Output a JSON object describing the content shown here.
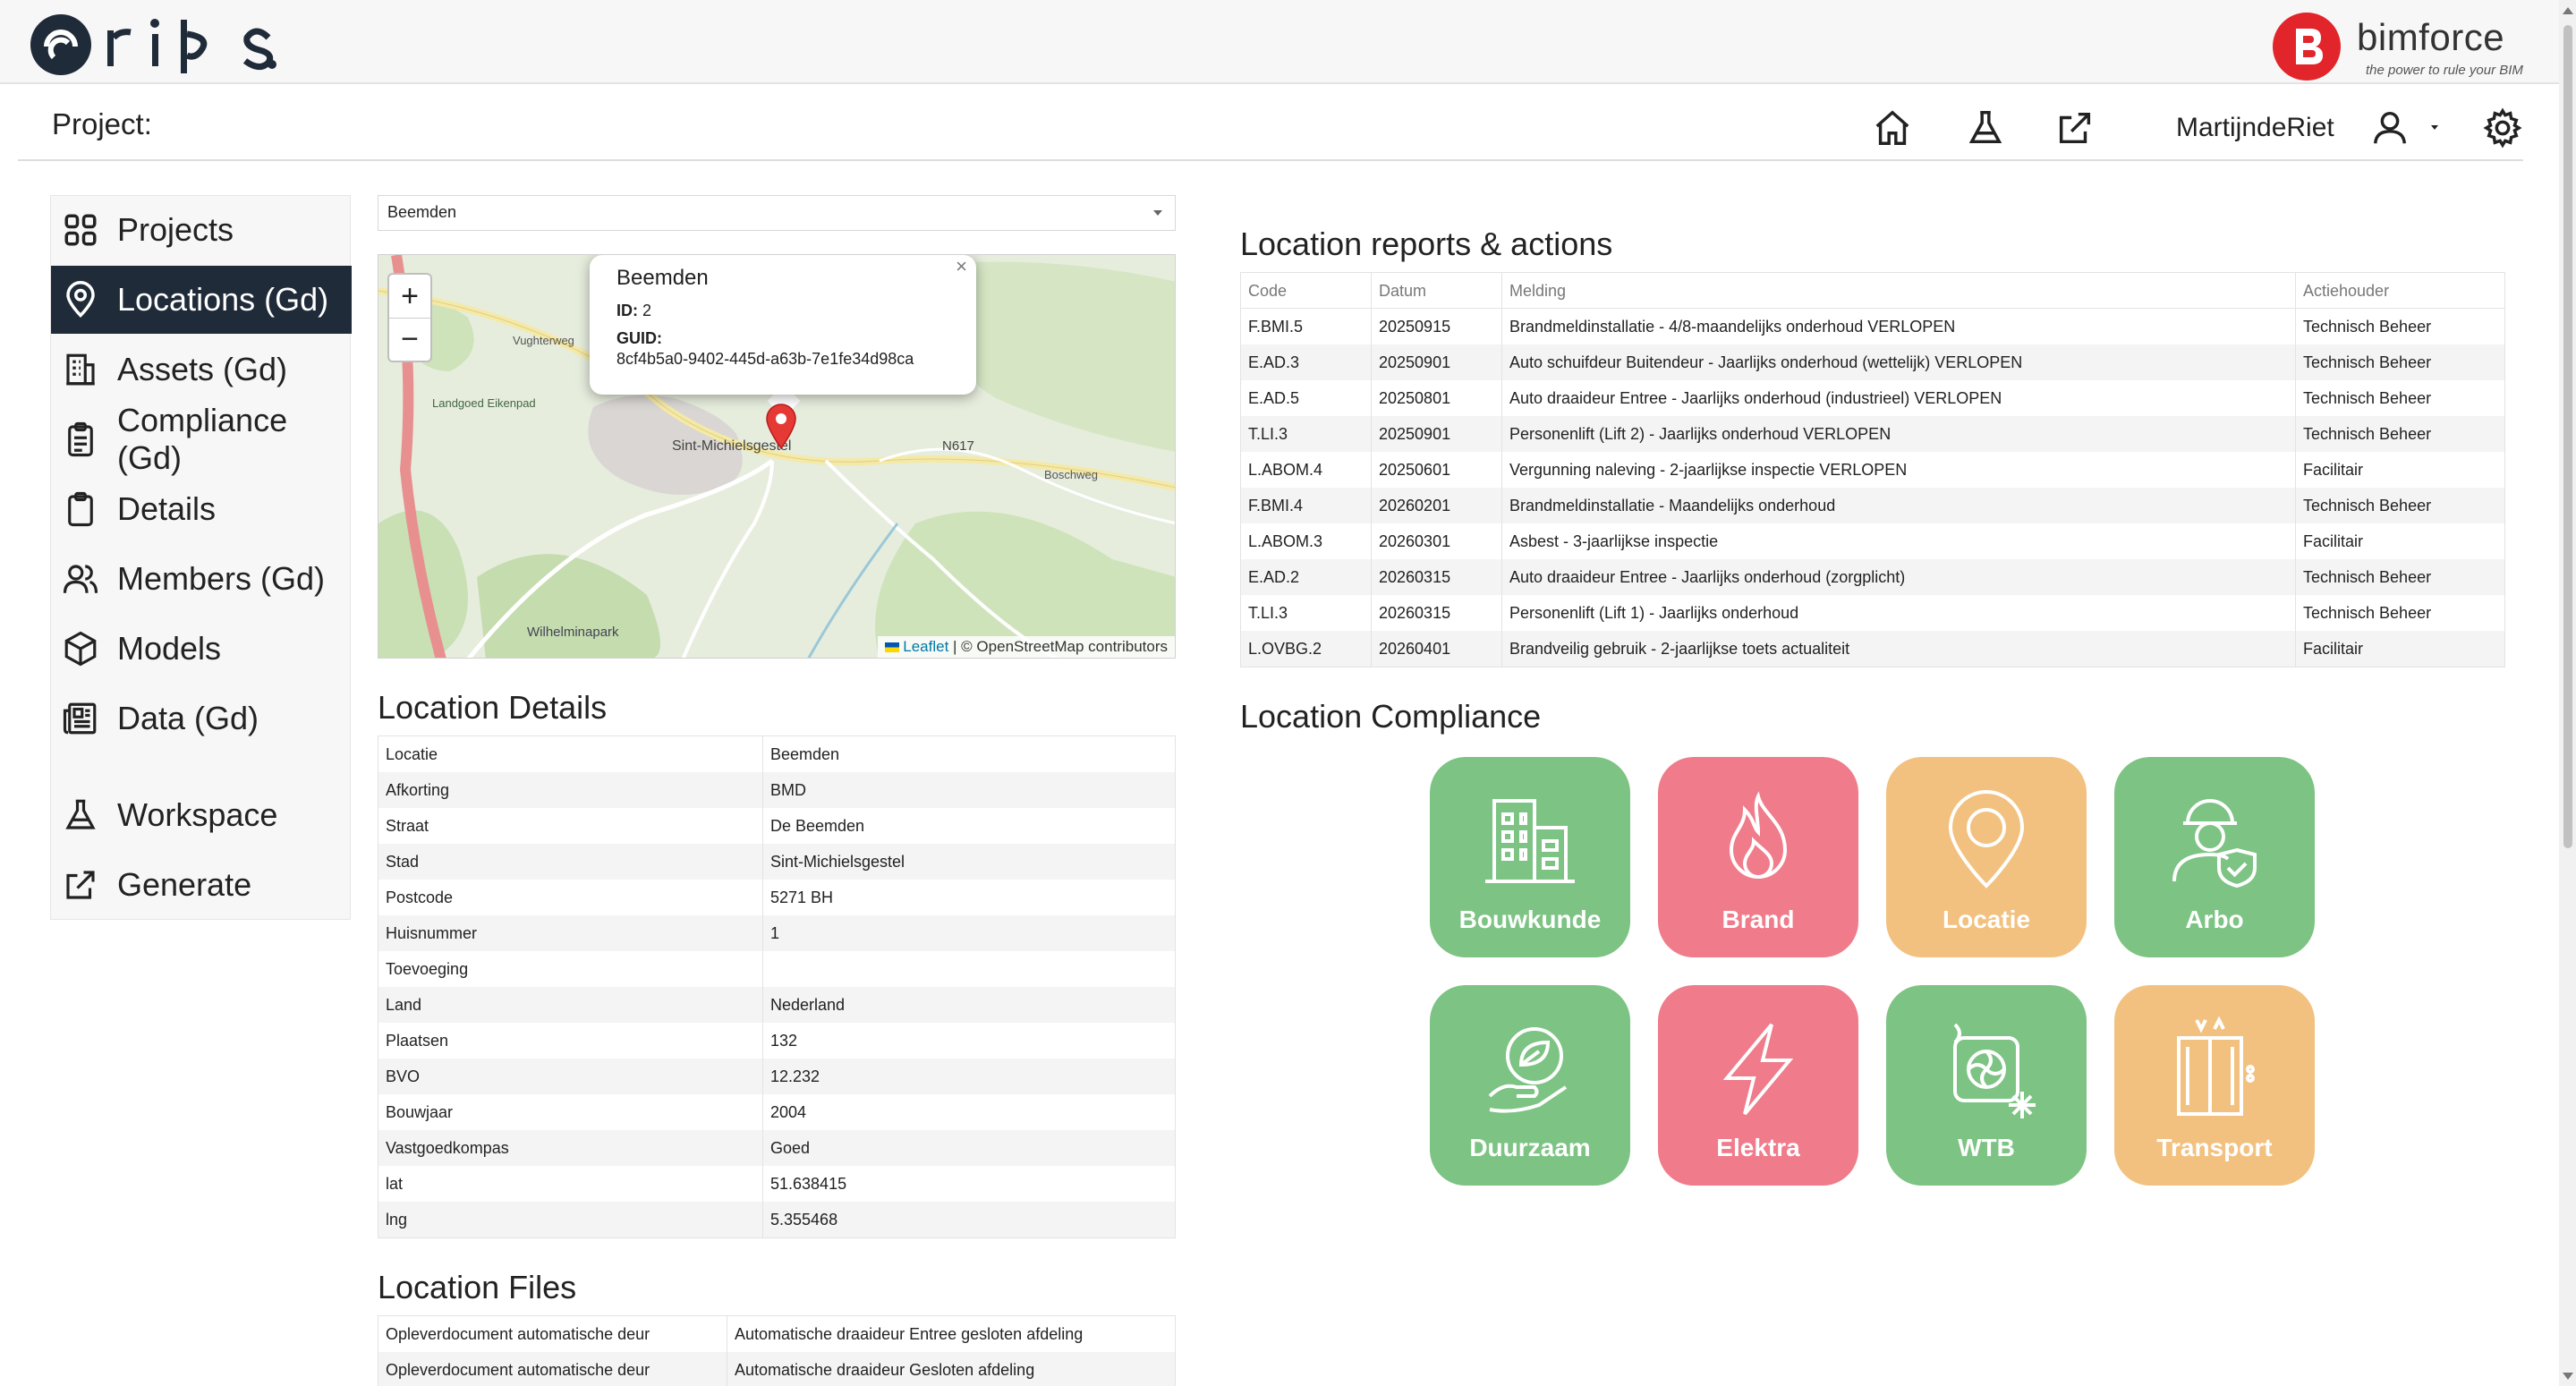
{
  "brand": {
    "app_name": "rips",
    "partner_name": "bimforce",
    "partner_tagline": "the power to rule your BIM",
    "partner_color": "#e2242b"
  },
  "header": {
    "project_label": "Project:",
    "user_name": "MartijndeRiet"
  },
  "sidebar": {
    "items": [
      {
        "label": "Projects",
        "icon": "grid-icon"
      },
      {
        "label": "Locations (Gd)",
        "icon": "map-pin-icon",
        "active": true
      },
      {
        "label": "Assets (Gd)",
        "icon": "building-icon"
      },
      {
        "label": "Compliance (Gd)",
        "icon": "clipboard-check-icon"
      },
      {
        "label": "Details",
        "icon": "clipboard-icon"
      },
      {
        "label": "Members (Gd)",
        "icon": "people-icon"
      },
      {
        "label": "Models",
        "icon": "cube-icon"
      },
      {
        "label": "Data (Gd)",
        "icon": "newspaper-icon"
      },
      {
        "label": "Workspace",
        "icon": "flask-icon"
      },
      {
        "label": "Generate",
        "icon": "external-link-icon"
      }
    ]
  },
  "location_select": {
    "value": "Beemden"
  },
  "map": {
    "popup": {
      "title": "Beemden",
      "id_label": "ID:",
      "id_value": "2",
      "guid_label": "GUID:",
      "guid_value": "8cf4b5a0-9402-445d-a63b-7e1fe34d98ca"
    },
    "labels": {
      "town": "Sint-Michielsgestel",
      "road": "N617",
      "park": "Wilhelminapark",
      "estate": "Landgoed Eikenpad",
      "street1": "Boschweg",
      "street2": "Vughterweg"
    },
    "attribution": {
      "leaflet": "Leaflet",
      "rest": "| © OpenStreetMap contributors"
    }
  },
  "location_details": {
    "title": "Location Details",
    "rows": [
      {
        "key": "Locatie",
        "value": "Beemden"
      },
      {
        "key": "Afkorting",
        "value": "BMD"
      },
      {
        "key": "Straat",
        "value": "De Beemden"
      },
      {
        "key": "Stad",
        "value": "Sint-Michielsgestel"
      },
      {
        "key": "Postcode",
        "value": "5271 BH"
      },
      {
        "key": "Huisnummer",
        "value": "1"
      },
      {
        "key": "Toevoeging",
        "value": ""
      },
      {
        "key": "Land",
        "value": "Nederland"
      },
      {
        "key": "Plaatsen",
        "value": "132"
      },
      {
        "key": "BVO",
        "value": "12.232"
      },
      {
        "key": "Bouwjaar",
        "value": "2004"
      },
      {
        "key": "Vastgoedkompas",
        "value": "Goed"
      },
      {
        "key": "lat",
        "value": "51.638415"
      },
      {
        "key": "lng",
        "value": "5.355468"
      }
    ]
  },
  "location_files": {
    "title": "Location Files",
    "rows": [
      {
        "key": "Opleverdocument automatische deur",
        "value": "Automatische draaideur Entree gesloten afdeling"
      },
      {
        "key": "Opleverdocument automatische deur",
        "value": "Automatische draaideur Gesloten afdeling"
      }
    ]
  },
  "reports": {
    "title": "Location reports & actions",
    "columns": [
      "Code",
      "Datum",
      "Melding",
      "Actiehouder"
    ],
    "rows": [
      [
        "F.BMI.5",
        "20250915",
        "Brandmeldinstallatie - 4/8-maandelijks onderhoud VERLOPEN",
        "Technisch Beheer"
      ],
      [
        "E.AD.3",
        "20250901",
        "Auto schuifdeur Buitendeur - Jaarlijks onderhoud (wettelijk) VERLOPEN",
        "Technisch Beheer"
      ],
      [
        "E.AD.5",
        "20250801",
        "Auto draaideur Entree - Jaarlijks onderhoud (industrieel) VERLOPEN",
        "Technisch Beheer"
      ],
      [
        "T.LI.3",
        "20250901",
        "Personenlift (Lift 2) - Jaarlijks onderhoud VERLOPEN",
        "Technisch Beheer"
      ],
      [
        "L.ABOM.4",
        "20250601",
        "Vergunning naleving - 2-jaarlijkse inspectie VERLOPEN",
        "Facilitair"
      ],
      [
        "F.BMI.4",
        "20260201",
        "Brandmeldinstallatie - Maandelijks onderhoud",
        "Technisch Beheer"
      ],
      [
        "L.ABOM.3",
        "20260301",
        "Asbest - 3-jaarlijkse inspectie",
        "Facilitair"
      ],
      [
        "E.AD.2",
        "20260315",
        "Auto draaideur Entree - Jaarlijks onderhoud (zorgplicht)",
        "Technisch Beheer"
      ],
      [
        "T.LI.3",
        "20260315",
        "Personenlift (Lift 1) - Jaarlijks onderhoud",
        "Technisch Beheer"
      ],
      [
        "L.OVBG.2",
        "20260401",
        "Brandveilig gebruik - 2-jaarlijkse toets actualiteit",
        "Facilitair"
      ]
    ]
  },
  "compliance": {
    "title": "Location Compliance",
    "tiles": [
      {
        "label": "Bouwkunde",
        "color": "#7dc384",
        "icon": "building-icon"
      },
      {
        "label": "Brand",
        "color": "#f07b8a",
        "icon": "flame-icon"
      },
      {
        "label": "Locatie",
        "color": "#f2c17f",
        "icon": "map-pin-icon"
      },
      {
        "label": "Arbo",
        "color": "#7dc384",
        "icon": "worker-shield-icon"
      },
      {
        "label": "Duurzaam",
        "color": "#7dc384",
        "icon": "leaf-hand-icon"
      },
      {
        "label": "Elektra",
        "color": "#f07b8a",
        "icon": "lightning-icon"
      },
      {
        "label": "WTB",
        "color": "#7dc384",
        "icon": "hvac-fan-icon"
      },
      {
        "label": "Transport",
        "color": "#f2c17f",
        "icon": "elevator-icon"
      }
    ]
  }
}
